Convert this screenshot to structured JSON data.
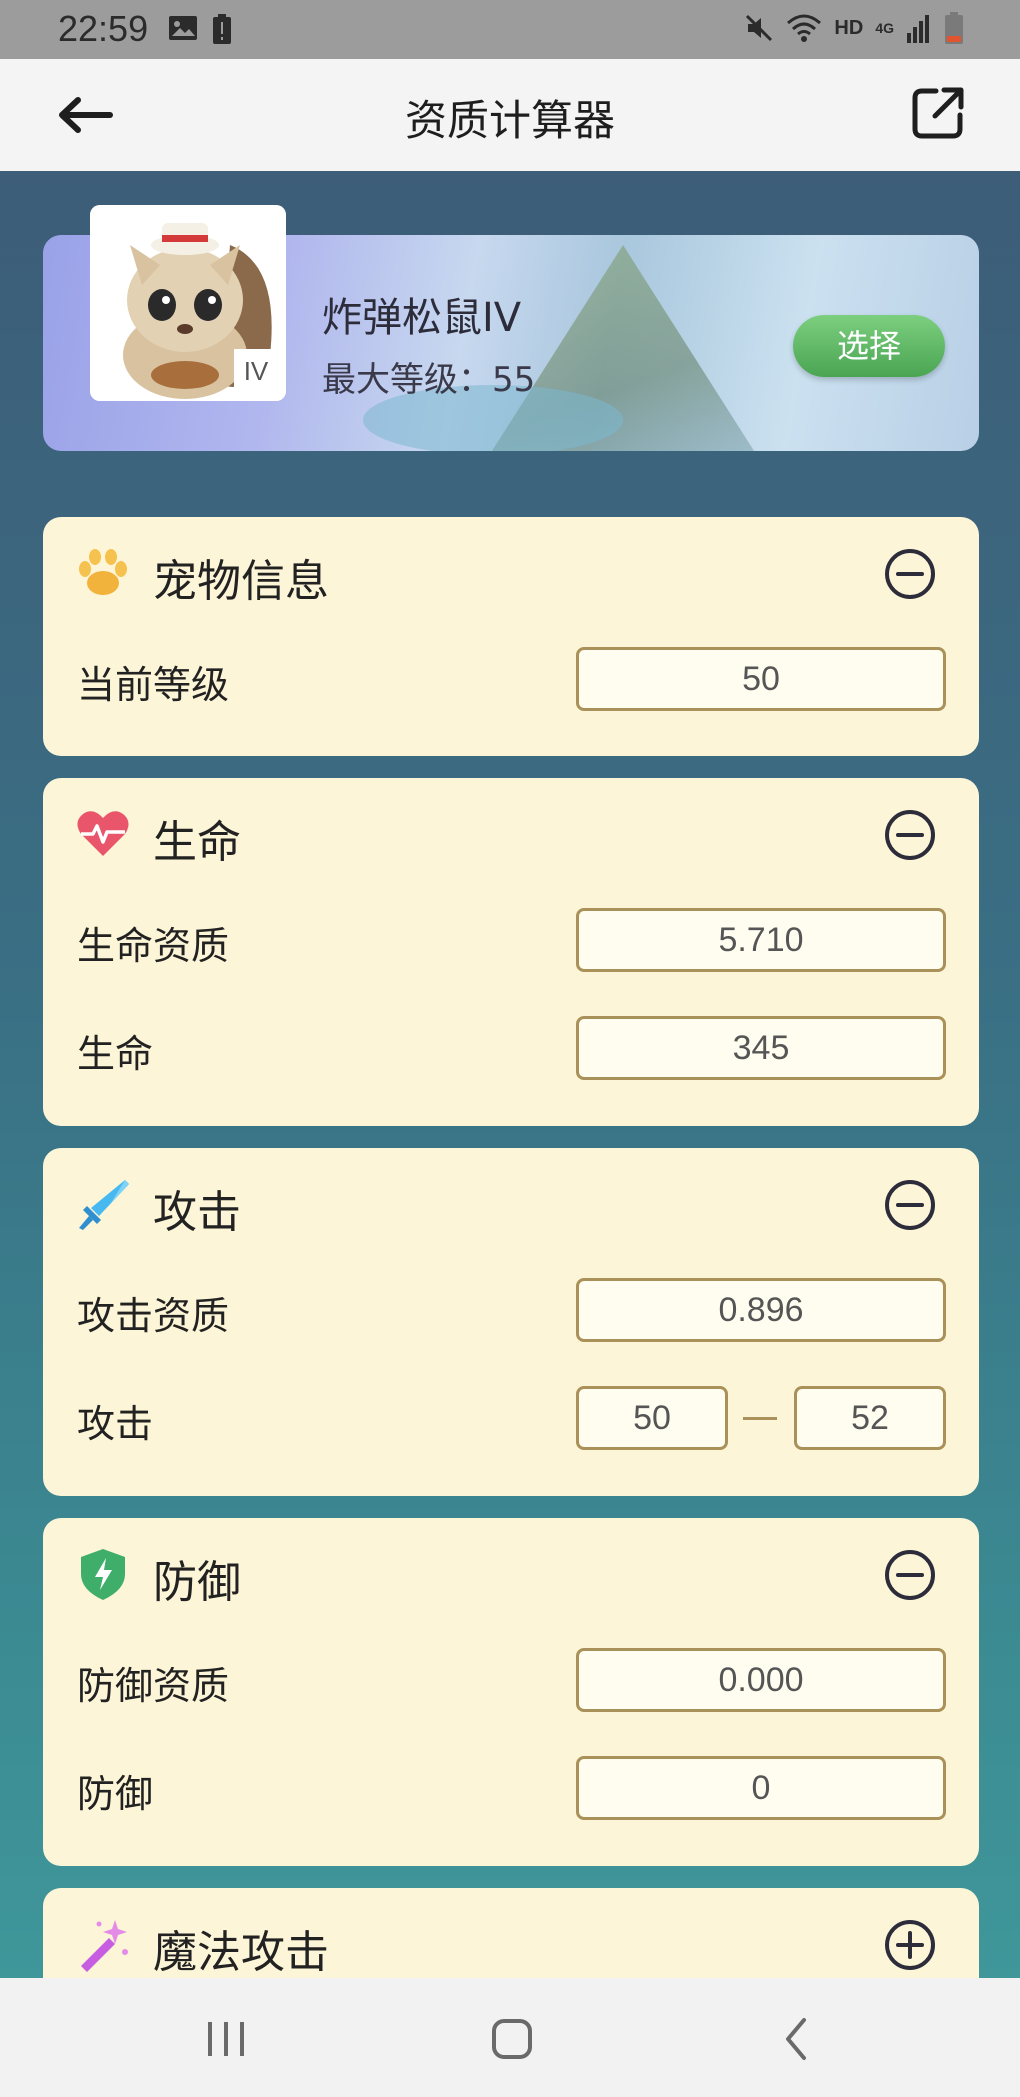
{
  "status_bar": {
    "time": "22:59",
    "icons_left": [
      "image-icon",
      "battery-alert-icon"
    ],
    "icons_right": [
      "mute-icon",
      "wifi-icon",
      "hd-icon",
      "signal-4g-icon",
      "battery-low-icon"
    ],
    "hd_label": "HD",
    "network_label": "4G"
  },
  "app_bar": {
    "title": "资质计算器",
    "back_icon": "arrow-left-icon",
    "share_icon": "external-link-icon"
  },
  "pet": {
    "name": "炸弹松鼠IV",
    "max_level_text": "最大等级：55",
    "tier_badge": "IV",
    "select_label": "选择"
  },
  "sections": {
    "info": {
      "title": "宠物信息",
      "icon": "paw-icon",
      "toggle": "collapse",
      "rows": [
        {
          "label": "当前等级",
          "value": "50"
        }
      ]
    },
    "hp": {
      "title": "生命",
      "icon": "heart-icon",
      "toggle": "collapse",
      "rows": [
        {
          "label": "生命资质",
          "value": "5.710"
        },
        {
          "label": "生命",
          "value": "345"
        }
      ]
    },
    "attack": {
      "title": "攻击",
      "icon": "sword-icon",
      "toggle": "collapse",
      "rows": [
        {
          "label": "攻击资质",
          "value": "0.896"
        },
        {
          "label": "攻击",
          "min": "50",
          "max": "52"
        }
      ]
    },
    "defense": {
      "title": "防御",
      "icon": "shield-icon",
      "toggle": "collapse",
      "rows": [
        {
          "label": "防御资质",
          "value": "0.000"
        },
        {
          "label": "防御",
          "value": "0"
        }
      ]
    },
    "magic": {
      "title": "魔法攻击",
      "icon": "magic-wand-icon",
      "toggle": "expand"
    }
  },
  "nav_bar": {
    "buttons": [
      "recent-apps-icon",
      "home-icon",
      "back-icon"
    ]
  },
  "colors": {
    "card_bg": "#fdf5d7",
    "field_border": "#a99159",
    "select_button": "#5bb462",
    "app_bar_bg": "#f4f4f4"
  }
}
